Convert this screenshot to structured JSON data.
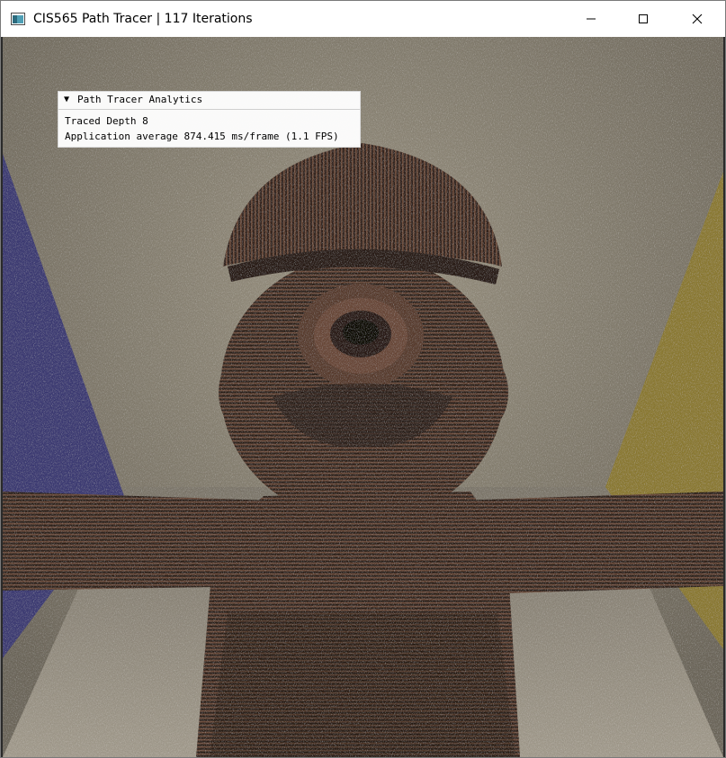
{
  "window": {
    "title": "CIS565 Path Tracer | 117 Iterations"
  },
  "analytics_panel": {
    "collapse_glyph": "▼",
    "header": "Path Tracer Analytics",
    "traced_depth": "Traced Depth 8",
    "frame_stats": "Application average 874.415 ms/frame (1.1 FPS)"
  },
  "colors": {
    "left_wall": "#3d3b6e",
    "right_wall": "#8a7a36",
    "back_wall": "#8e887a",
    "floor": "#8a8478",
    "figure": "#3a2c24"
  },
  "icons": [
    "app-icon",
    "minimize-icon",
    "maximize-icon",
    "close-icon",
    "collapse-arrow-icon"
  ]
}
